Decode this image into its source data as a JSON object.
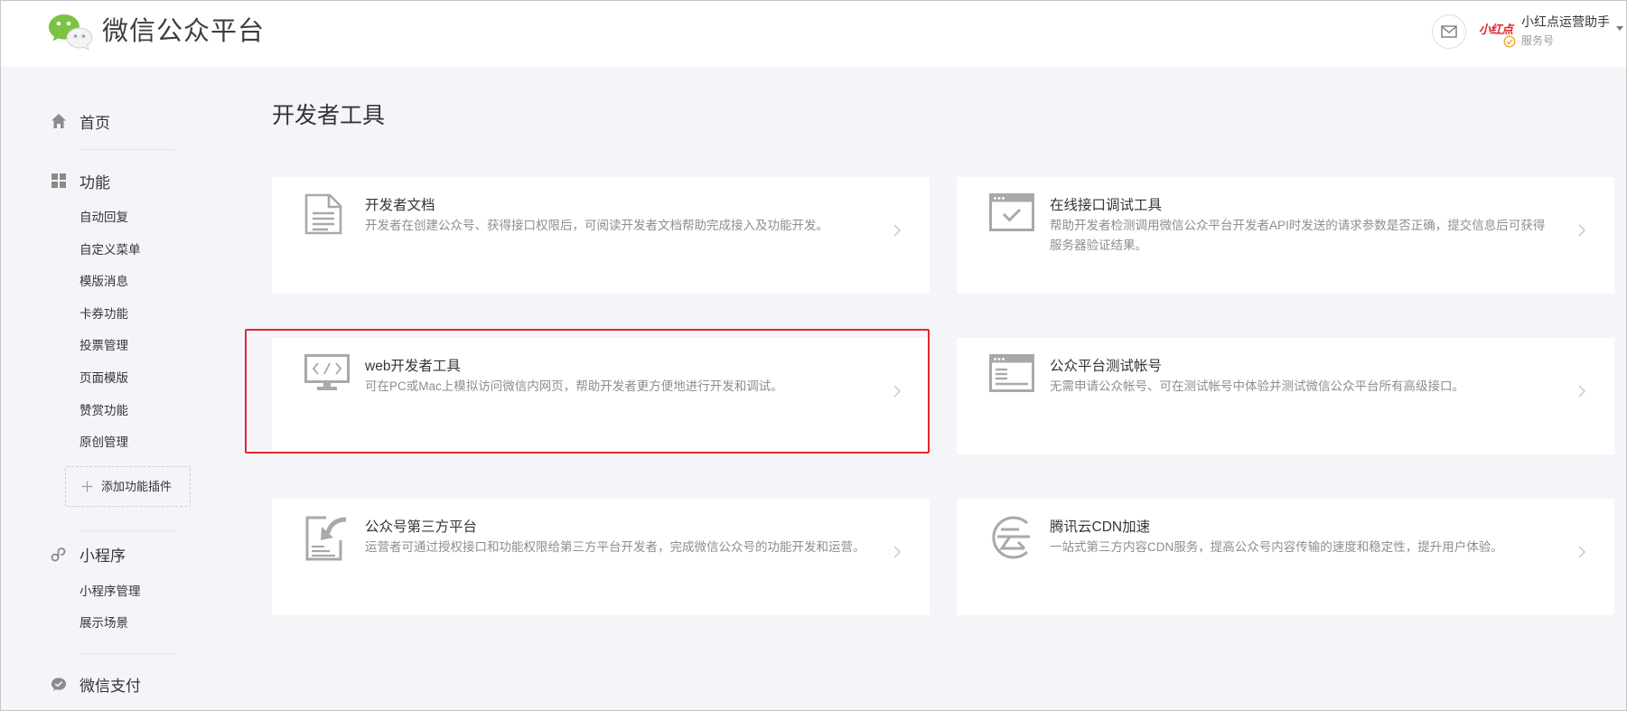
{
  "header": {
    "logo_text": "微信公众平台",
    "brand_mark": "小红点",
    "account_name": "小红点运营助手",
    "account_type": "服务号",
    "icons": {
      "logo": "wechat-logo-icon",
      "mail": "mail-icon",
      "verified": "verified-badge-icon",
      "dropdown": "caret-down-icon"
    }
  },
  "sidebar": {
    "home": {
      "label": "首页",
      "icon": "home-icon"
    },
    "features": {
      "label": "功能",
      "icon": "grid-icon",
      "items": [
        "自动回复",
        "自定义菜单",
        "模版消息",
        "卡券功能",
        "投票管理",
        "页面模版",
        "赞赏功能",
        "原创管理"
      ]
    },
    "add_plugin": {
      "label": "添加功能插件",
      "icon": "plus-icon"
    },
    "mini_program": {
      "label": "小程序",
      "icon": "mini-program-icon",
      "items": [
        "小程序管理",
        "展示场景"
      ]
    },
    "wechat_pay": {
      "label": "微信支付",
      "icon": "wechat-pay-icon"
    }
  },
  "main": {
    "title": "开发者工具",
    "cards": [
      {
        "title": "开发者文档",
        "desc": [
          "开发者在创建公众号、获得接口权限后，可阅读开发者文档帮助完成接入及功能开发。"
        ],
        "icon": "document-icon",
        "highlighted": false
      },
      {
        "title": "在线接口调试工具",
        "desc": [
          "帮助开发者检测调用微信公众平台开发者API时发送的请求参数是否正确，提交信息后可获得",
          "服务器验证结果。"
        ],
        "icon": "browser-check-icon",
        "highlighted": false
      },
      {
        "title": "web开发者工具",
        "desc": [
          "可在PC或Mac上模拟访问微信内网页，帮助开发者更方便地进行开发和调试。"
        ],
        "icon": "monitor-code-icon",
        "highlighted": true
      },
      {
        "title": "公众平台测试帐号",
        "desc": [
          "无需申请公众帐号、可在测试帐号中体验并测试微信公众平台所有高级接口。"
        ],
        "icon": "browser-window-icon",
        "highlighted": false
      },
      {
        "title": "公众号第三方平台",
        "desc": [
          "运营者可通过授权接口和功能权限给第三方平台开发者，完成微信公众号的功能开发和运营。"
        ],
        "icon": "third-party-icon",
        "highlighted": false
      },
      {
        "title": "腾讯云CDN加速",
        "desc": [
          "一站式第三方内容CDN服务，提高公众号内容传输的速度和稳定性，提升用户体验。"
        ],
        "icon": "tencent-cloud-icon",
        "highlighted": false
      }
    ]
  },
  "colors": {
    "brand_green": "#7cc244",
    "highlight_red": "#e5262b",
    "background": "#f4f5f9",
    "card_background": "#ffffff",
    "icon_gray": "#a9a9a9",
    "text_primary": "#353535",
    "text_secondary": "#8e8e8e"
  }
}
